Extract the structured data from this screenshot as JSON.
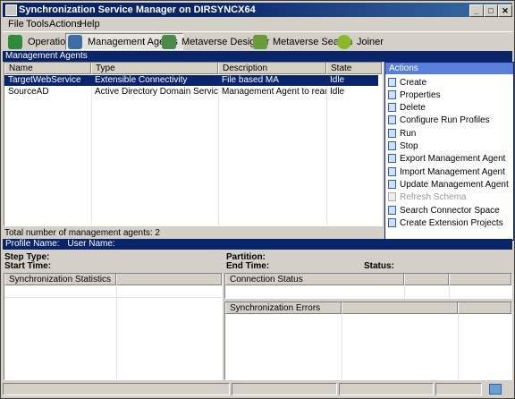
{
  "window": {
    "title": "Synchronization Service Manager on DIRSYNCX64",
    "min": "_",
    "max": "□",
    "close": "✕"
  },
  "menu": [
    "File",
    "Tools",
    "Actions",
    "Help"
  ],
  "toolbar": [
    {
      "label": "Operations",
      "icon": "operations-icon",
      "color": "#2e8b3a",
      "active": false
    },
    {
      "label": "Management Agents",
      "icon": "management-agents-icon",
      "color": "#3a6ea5",
      "active": true
    },
    {
      "label": "Metaverse Designer",
      "icon": "metaverse-designer-icon",
      "color": "#4a8a4a",
      "active": false
    },
    {
      "label": "Metaverse Search",
      "icon": "metaverse-search-icon",
      "color": "#6a9a3a",
      "active": false
    },
    {
      "label": "Joiner",
      "icon": "joiner-icon",
      "color": "#8ab82a",
      "active": false
    }
  ],
  "ma_section": "Management Agents",
  "ma_table": {
    "columns": [
      "Name",
      "Type",
      "Description",
      "State"
    ],
    "rows": [
      {
        "name": "TargetWebService",
        "type": "Extensible Connectivity",
        "description": "File based MA",
        "state": "Idle",
        "selected": true
      },
      {
        "name": "SourceAD",
        "type": "Active Directory Domain Services",
        "description": "Management Agent to read fro...",
        "state": "Idle",
        "selected": false
      }
    ]
  },
  "actions": {
    "title": "Actions",
    "items": [
      {
        "label": "Create",
        "enabled": true
      },
      {
        "label": "Properties",
        "enabled": true
      },
      {
        "label": "Delete",
        "enabled": true
      },
      {
        "label": "Configure Run Profiles",
        "enabled": true
      },
      {
        "label": "Run",
        "enabled": true
      },
      {
        "label": "Stop",
        "enabled": true
      },
      {
        "label": "Export Management Agent",
        "enabled": true
      },
      {
        "label": "Import Management Agent",
        "enabled": true
      },
      {
        "label": "Update Management Agent",
        "enabled": true
      },
      {
        "label": "Refresh Schema",
        "enabled": false
      },
      {
        "label": "Search Connector Space",
        "enabled": true
      },
      {
        "label": "Create Extension Projects",
        "enabled": true
      }
    ]
  },
  "total_text": "Total number of management agents: 2",
  "profile_bar": {
    "profile_label": "Profile Name:",
    "user_label": "User Name:"
  },
  "details": {
    "step_type": "Step Type:",
    "start_time": "Start Time:",
    "partition": "Partition:",
    "end_time": "End Time:",
    "status": "Status:"
  },
  "panels": {
    "sync_stats": "Synchronization Statistics",
    "connection_status": "Connection Status",
    "sync_errors": "Synchronization Errors"
  },
  "colors": {
    "selection": "#0a246a",
    "titlebar": "#0a246a",
    "face": "#d4d0c8"
  }
}
